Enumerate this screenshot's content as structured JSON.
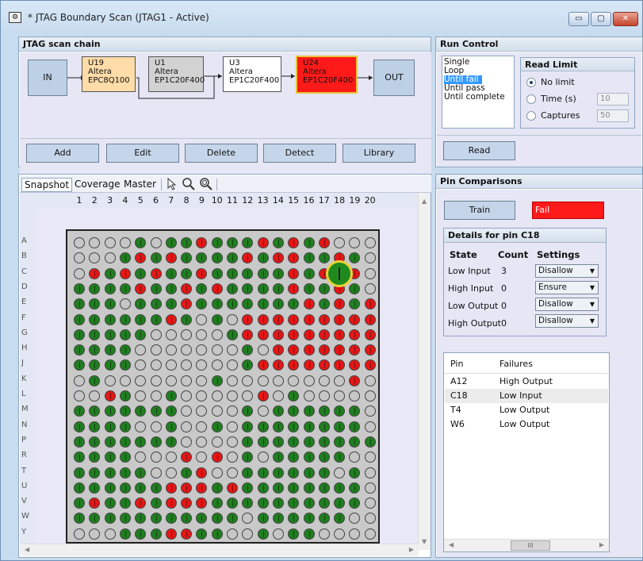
{
  "window": {
    "title": "* JTAG Boundary Scan (JTAG1 - Active)",
    "controls": [
      "▭",
      "▢",
      "✕"
    ]
  },
  "scan_chain": {
    "title": "JTAG scan chain",
    "in_label": "IN",
    "out_label": "OUT",
    "devices": [
      {
        "id": "U19",
        "vendor": "Altera",
        "part": "EPC8Q100",
        "color": "#ffdca8"
      },
      {
        "id": "U1",
        "vendor": "Altera",
        "part": "EP1C20F400",
        "color": "#d2d2d2"
      },
      {
        "id": "U3",
        "vendor": "Altera",
        "part": "EP1C20F400",
        "color": "#ffffff"
      },
      {
        "id": "U24",
        "vendor": "Altera",
        "part": "EP1C20F400",
        "color": "#ff1a1a"
      }
    ],
    "buttons": [
      "Add",
      "Edit",
      "Delete",
      "Detect",
      "Library"
    ]
  },
  "view_tabs": [
    "Snapshot",
    "Coverage",
    "Master"
  ],
  "tool_icons": [
    "pointer-icon",
    "zoom-icon",
    "zoom-fit-icon"
  ],
  "grid": {
    "columns": [
      "1",
      "2",
      "3",
      "4",
      "5",
      "6",
      "7",
      "8",
      "9",
      "10",
      "11",
      "12",
      "13",
      "14",
      "15",
      "16",
      "17",
      "18",
      "19",
      "20"
    ],
    "rows": [
      "A",
      "B",
      "C",
      "D",
      "E",
      "F",
      "G",
      "H",
      "J",
      "K",
      "L",
      "M",
      "N",
      "P",
      "R",
      "T",
      "U",
      "V",
      "W",
      "Y"
    ],
    "pins": [
      "xxxxgxggrgggrgrgrxxx",
      "xxxgrgrggggrgrrggrgx",
      "xrgrgrggrgggggrgrrrx",
      "ggggrggrgrggggrggrgx",
      "gggxgggrgggggggrgrgr",
      "ggggggrgxgxrrrrrrrrr",
      "gggggxxxxxgrrrrrrrrr",
      "ggggxxxxxxxgxrrrrrrr",
      "ggggxxxxxxxgrrrrrrrr",
      "xgxxxxxxxgxxxxxxxxrx",
      "xxrgxxgxxxxxrxgxxxxx",
      "gggggggxxxxgxggggggx",
      "ggggxxgxxgxggggggggx",
      "gggggggxxxxggggggggg",
      "ggggxxxrxrxgxgggggxx",
      "gggggxxgrxxggggggxgx",
      "ggggggrrrgrggggggggx",
      "grggrgrrrggggggggggx",
      "gggggggggggxggggggxx",
      "xxxgggrrggxxgxggxxxx"
    ],
    "highlight": {
      "row": "C",
      "col": 18
    }
  },
  "run_control": {
    "title": "Run Control",
    "modes": [
      "Single",
      "Loop",
      "Until fail",
      "Until pass",
      "Until complete"
    ],
    "selected_mode": "Until fail",
    "read_limit_title": "Read Limit",
    "options": [
      {
        "label": "No limit",
        "selected": true
      },
      {
        "label": "Time (s)",
        "value": "10"
      },
      {
        "label": "Captures",
        "value": "50"
      }
    ],
    "read_button": "Read"
  },
  "pin_comparisons": {
    "title": "Pin Comparisons",
    "train_button": "Train",
    "status": "Fail",
    "status_color": "#ff1a1a",
    "details_title": "Details for pin C18",
    "headers": [
      "State",
      "Count",
      "Settings"
    ],
    "rows": [
      {
        "state": "Low Input",
        "count": "3",
        "setting": "Disallow"
      },
      {
        "state": "High Input",
        "count": "0",
        "setting": "Ensure"
      },
      {
        "state": "Low Output",
        "count": "0",
        "setting": "Disallow"
      },
      {
        "state": "High Output",
        "count": "0",
        "setting": "Disallow"
      }
    ],
    "failures_headers": [
      "Pin",
      "Failures"
    ],
    "failures": [
      {
        "pin": "A12",
        "failure": "High Output"
      },
      {
        "pin": "C18",
        "failure": "Low Input"
      },
      {
        "pin": "T4",
        "failure": "Low Output"
      },
      {
        "pin": "W6",
        "failure": "Low Output"
      }
    ],
    "scroll_mark": "III"
  }
}
